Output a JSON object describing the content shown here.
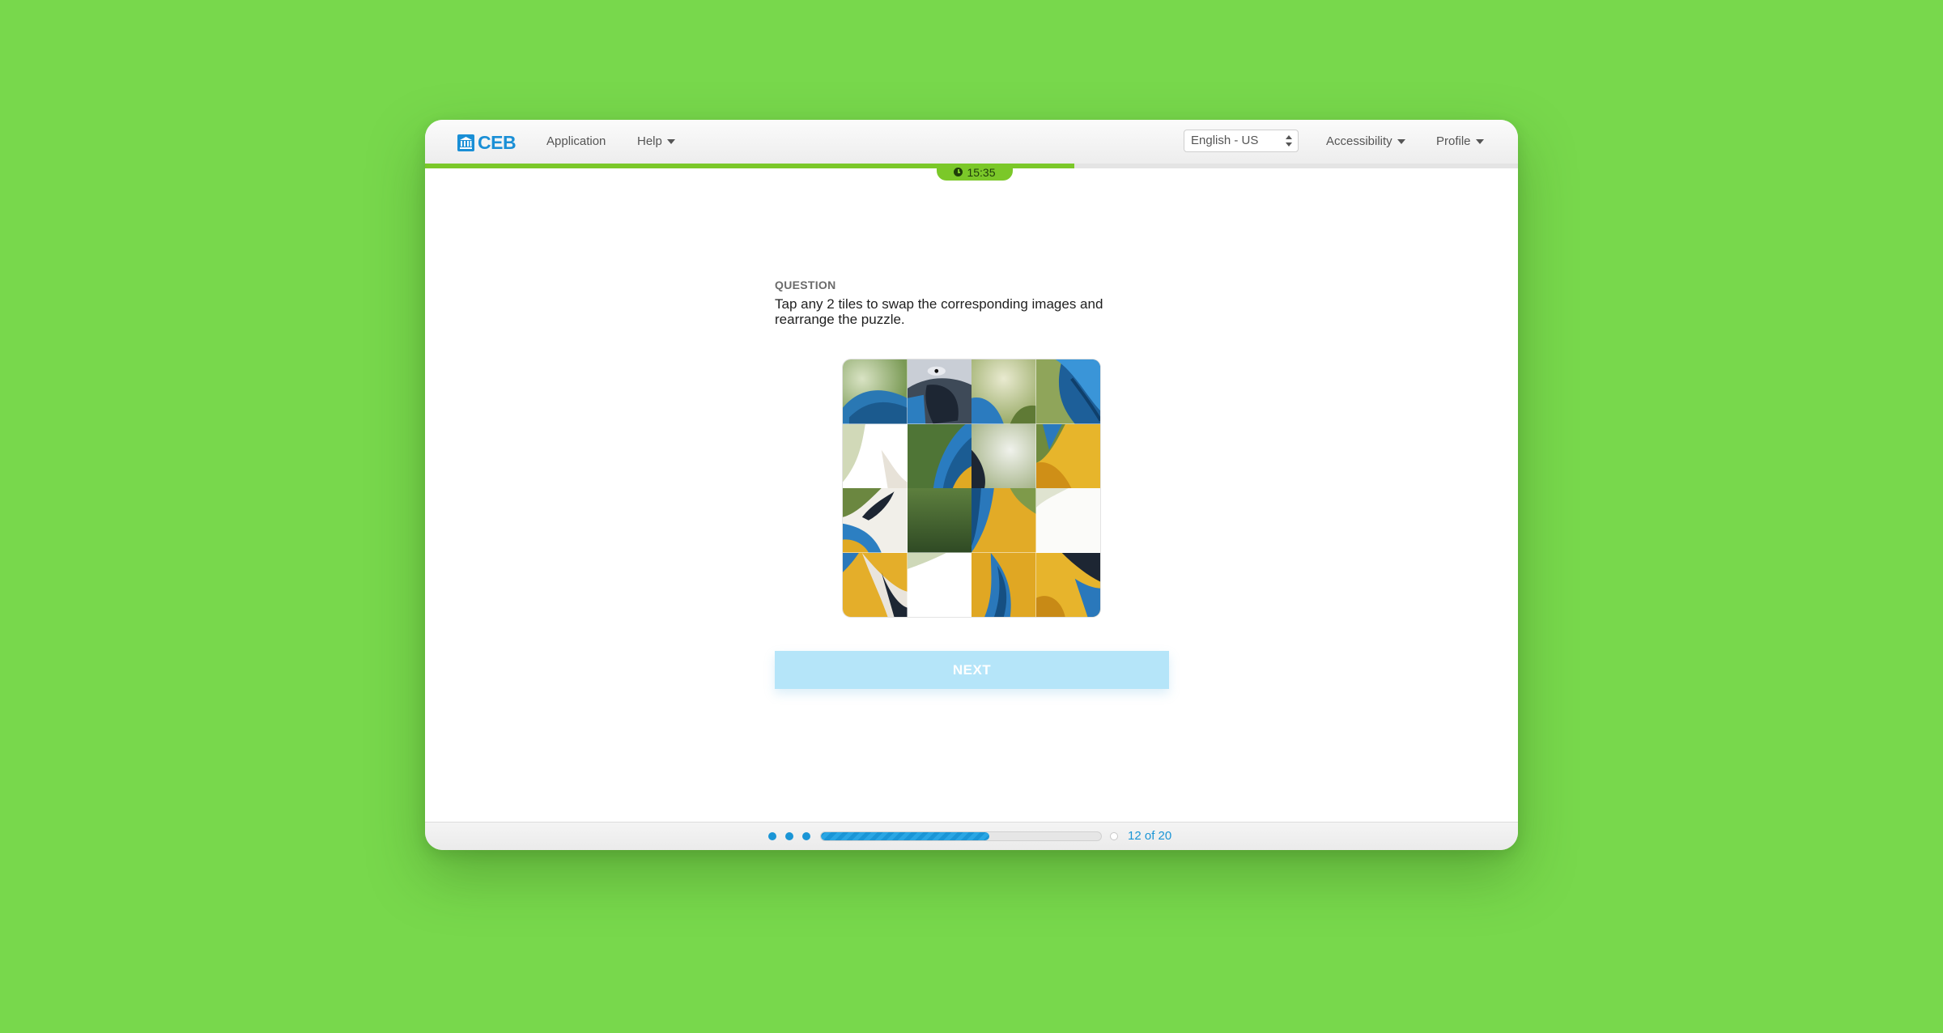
{
  "header": {
    "logo_text": "CEB",
    "nav": {
      "application": "Application",
      "help": "Help",
      "accessibility": "Accessibility",
      "profile": "Profile"
    },
    "language_selected": "English - US"
  },
  "timer": {
    "time": "15:35",
    "elapsed_fraction": 0.594,
    "color": "#7bc829"
  },
  "question": {
    "label": "QUESTION",
    "text": "Tap any 2 tiles to swap the corresponding images and rearrange the puzzle."
  },
  "puzzle": {
    "rows": 4,
    "cols": 4,
    "tiles": [
      "tile-1",
      "tile-2",
      "tile-3",
      "tile-4",
      "tile-5",
      "tile-6",
      "tile-7",
      "tile-8",
      "tile-9",
      "tile-10",
      "tile-11",
      "tile-12",
      "tile-13",
      "tile-14",
      "tile-15",
      "tile-16"
    ]
  },
  "next_button": {
    "label": "NEXT",
    "color": "#b5e5f9"
  },
  "footer": {
    "completed_dots": 3,
    "progress_fraction": 0.6,
    "count_label": "12 of 20",
    "accent": "#1a95d6"
  }
}
